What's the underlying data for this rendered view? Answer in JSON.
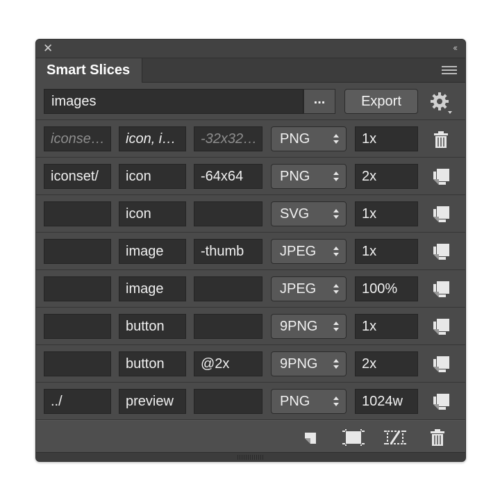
{
  "window": {
    "title_tab": "Smart Slices"
  },
  "toolbar": {
    "folder_value": "images",
    "browse_label": "...",
    "export_label": "Export"
  },
  "rows": [
    {
      "c1": "iconse…",
      "c2": "icon, i…",
      "c3": "-32x32…",
      "format": "PNG",
      "scale": "1x",
      "c1_placeholder": true,
      "c3_placeholder": true,
      "action": "trash-icon"
    },
    {
      "c1": "iconset/",
      "c2": "icon",
      "c3": "-64x64",
      "format": "PNG",
      "scale": "2x",
      "action": "duplicate-icon"
    },
    {
      "c1": "",
      "c2": "icon",
      "c3": "",
      "format": "SVG",
      "scale": "1x",
      "action": "duplicate-icon"
    },
    {
      "c1": "",
      "c2": "image",
      "c3": "-thumb",
      "format": "JPEG",
      "scale": "1x",
      "action": "duplicate-icon"
    },
    {
      "c1": "",
      "c2": "image",
      "c3": "",
      "format": "JPEG",
      "scale": "100%",
      "action": "duplicate-icon"
    },
    {
      "c1": "",
      "c2": "button",
      "c3": "",
      "format": "9PNG",
      "scale": "1x",
      "action": "duplicate-icon"
    },
    {
      "c1": "",
      "c2": "button",
      "c3": "@2x",
      "format": "9PNG",
      "scale": "2x",
      "action": "duplicate-icon"
    },
    {
      "c1": "../",
      "c2": "preview",
      "c3": "",
      "format": "PNG",
      "scale": "1024w",
      "action": "duplicate-icon"
    }
  ],
  "footer": {
    "icons": [
      "new-slice-icon",
      "slice-selection-icon",
      "remove-slice-icon",
      "trash-icon"
    ]
  },
  "colors": {
    "panel_bg": "#4a4a4a",
    "field_bg": "#2f2f2f",
    "text": "#f0f0f0",
    "placeholder": "#8e8e8e"
  }
}
